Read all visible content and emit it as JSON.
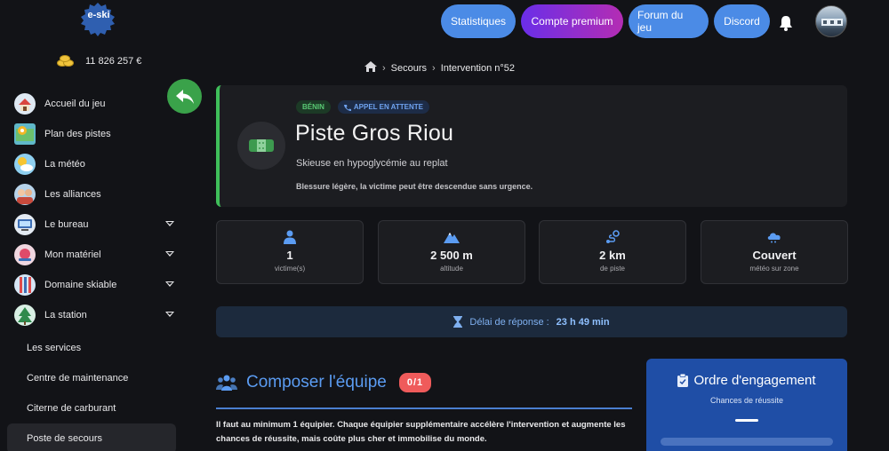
{
  "brand": {
    "logo_text": "e-ski"
  },
  "account": {
    "balance": "11 826 257 €"
  },
  "topbar": {
    "buttons": [
      "Statistiques",
      "Compte premium",
      "Forum du jeu",
      "Discord"
    ]
  },
  "sidebar": {
    "items": [
      {
        "label": "Accueil du jeu",
        "icon": "house-icon",
        "expandable": false
      },
      {
        "label": "Plan des pistes",
        "icon": "map-icon",
        "expandable": false
      },
      {
        "label": "La météo",
        "icon": "weather-icon",
        "expandable": false
      },
      {
        "label": "Les alliances",
        "icon": "alliance-icon",
        "expandable": false
      },
      {
        "label": "Le bureau",
        "icon": "office-icon",
        "expandable": true
      },
      {
        "label": "Mon matériel",
        "icon": "equipment-icon",
        "expandable": true
      },
      {
        "label": "Domaine skiable",
        "icon": "ski-area-icon",
        "expandable": true
      },
      {
        "label": "La station",
        "icon": "station-icon",
        "expandable": true
      }
    ],
    "subitems": [
      {
        "label": "Les services",
        "active": false
      },
      {
        "label": "Centre de maintenance",
        "active": false
      },
      {
        "label": "Citerne de carburant",
        "active": false
      },
      {
        "label": "Poste de secours",
        "active": true
      }
    ]
  },
  "breadcrumb": {
    "section": "Secours",
    "current": "Intervention n°52"
  },
  "incident": {
    "country_badge": "BÉNIN",
    "status_badge": "APPEL EN ATTENTE",
    "title": "Piste Gros Riou",
    "subtitle": "Skieuse en hypoglycémie au replat",
    "description": "Blessure légère, la victime peut être descendue sans urgence."
  },
  "stats": [
    {
      "value": "1",
      "label": "victime(s)",
      "icon": "person-icon"
    },
    {
      "value": "2 500 m",
      "label": "altitude",
      "icon": "mountain-icon"
    },
    {
      "value": "2 km",
      "label": "de piste",
      "icon": "route-icon"
    },
    {
      "value": "Couvert",
      "label": "météo sur zone",
      "icon": "cloud-icon"
    }
  ],
  "delay": {
    "label": "Délai de réponse :",
    "value": "23 h 49 min"
  },
  "compose": {
    "title": "Composer l'équipe",
    "count": "0/1",
    "text": "Il faut au minimum 1 équipier. Chaque équipier supplémentaire accélère l'intervention et augmente les chances de réussite, mais coûte plus cher et immobilise du monde."
  },
  "engagement": {
    "title": "Ordre d'engagement",
    "subtitle": "Chances de réussite"
  },
  "colors": {
    "accent_blue": "#4b8be6",
    "success_green": "#3fbf5a",
    "danger_red": "#ef5b5b",
    "premium_purple": "#6a2ee8"
  }
}
